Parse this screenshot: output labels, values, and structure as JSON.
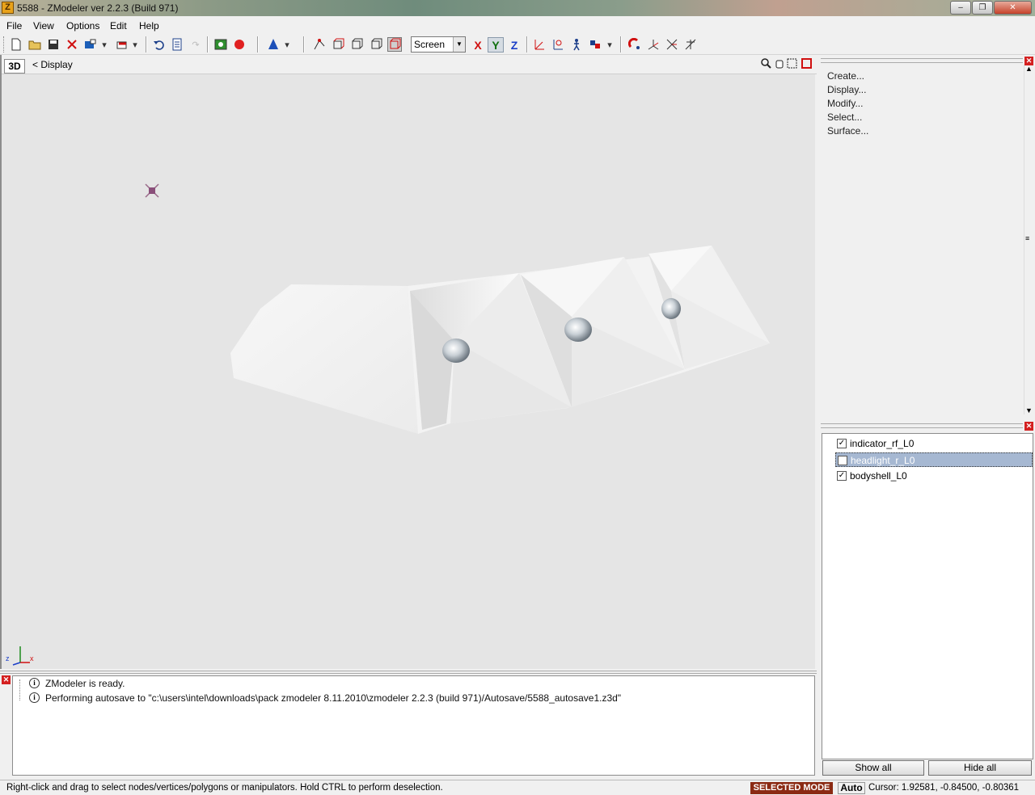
{
  "window": {
    "title": "5588 - ZModeler ver 2.2.3 (Build 971)",
    "icon": "Z",
    "minimize": "‒",
    "maximize": "❐",
    "close": "✕"
  },
  "menu": [
    {
      "label": "File"
    },
    {
      "label": "View"
    },
    {
      "label": "Options"
    },
    {
      "label": "Edit"
    },
    {
      "label": "Help"
    }
  ],
  "toolbar": {
    "view_mode": "Screen",
    "axis_x": "X",
    "axis_y": "Y",
    "axis_z": "Z"
  },
  "viewport": {
    "mode_button": "3D",
    "breadcrumb": "<   Display",
    "axis_z_label": "z",
    "axis_x_label": "x"
  },
  "commands": [
    "Create...",
    "Display...",
    "Modify...",
    "Select...",
    "Surface..."
  ],
  "layers": [
    {
      "name": "indicator_rf_L0",
      "checked": true,
      "selected": false
    },
    {
      "name": "headlight_r_L0",
      "checked": true,
      "selected": true
    },
    {
      "name": "bodyshell_L0",
      "checked": true,
      "selected": false
    }
  ],
  "layer_buttons": {
    "show_all": "Show all",
    "hide_all": "Hide all"
  },
  "log": [
    "ZModeler is ready.",
    "Performing autosave to \"c:\\users\\intel\\downloads\\pack zmodeler 8.11.2010\\zmodeler 2.2.3 (build 971)/Autosave/5588_autosave1.z3d\""
  ],
  "status": {
    "message": "Right-click and drag to select nodes/vertices/polygons or manipulators. Hold CTRL to perform deselection.",
    "mode": "SELECTED MODE",
    "auto": "Auto",
    "cursor": "Cursor: 1.92581, -0.84500, -0.80361"
  },
  "colors": {
    "mode_bg": "#8b2a13",
    "selection": "#a6b8d2",
    "viewport_bg": "#e5e5e5"
  }
}
